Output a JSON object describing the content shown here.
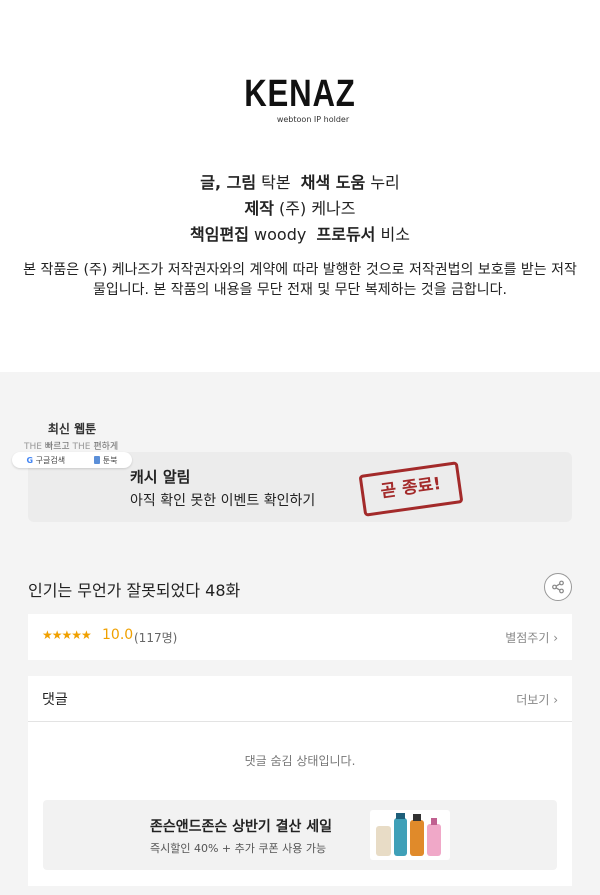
{
  "logo": {
    "name": "KENAZ",
    "sub": "webtoon IP holder"
  },
  "credits": {
    "line1": {
      "k1": "글, 그림",
      "v1": "탁본",
      "k2": "채색 도움",
      "v2": "누리"
    },
    "line2": {
      "k1": "제작",
      "v1": "(주) 케나즈"
    },
    "line3": {
      "k1": "책임편집",
      "v1": "woody",
      "k2": "프로듀서",
      "v2": "비소"
    }
  },
  "notice": "본 작품은 (주) 케나즈가 저작권자와의 계약에 따라 발행한 것으로 저작권법의 보호를 받는 저작물입니다. 본 작품의 내용을 무단 전재 및 무단 복제하는 것을 금합니다.",
  "mini": {
    "title": "최신 웹툰",
    "sub_the1": "THE",
    "sub_fast": "빠르고",
    "sub_the2": "THE",
    "sub_easy": "편하게",
    "btn_google": "구글검색",
    "btn_toonbook": "툰북"
  },
  "cash": {
    "title": "캐시 알림",
    "subtitle": "아직 확인 못한 이벤트 확인하기",
    "stamp": "곧 종료!"
  },
  "episode": {
    "title": "인기는 무언가 잘못되었다 48화"
  },
  "rating": {
    "stars": "★★★★★",
    "score": "10.0",
    "count": "(117명)",
    "link": "별점주기 ›"
  },
  "comments": {
    "title": "댓글",
    "more": "더보기 ›",
    "hidden": "댓글 숨김 상태입니다."
  },
  "ad": {
    "title": "존슨앤드존슨 상반기 결산 세일",
    "subtitle": "즉시할인 40% + 추가 쿠폰 사용 가능"
  },
  "colors": {
    "accent_star": "#f0a000",
    "stamp": "#a32a2a",
    "background": "#f4f4f4"
  }
}
